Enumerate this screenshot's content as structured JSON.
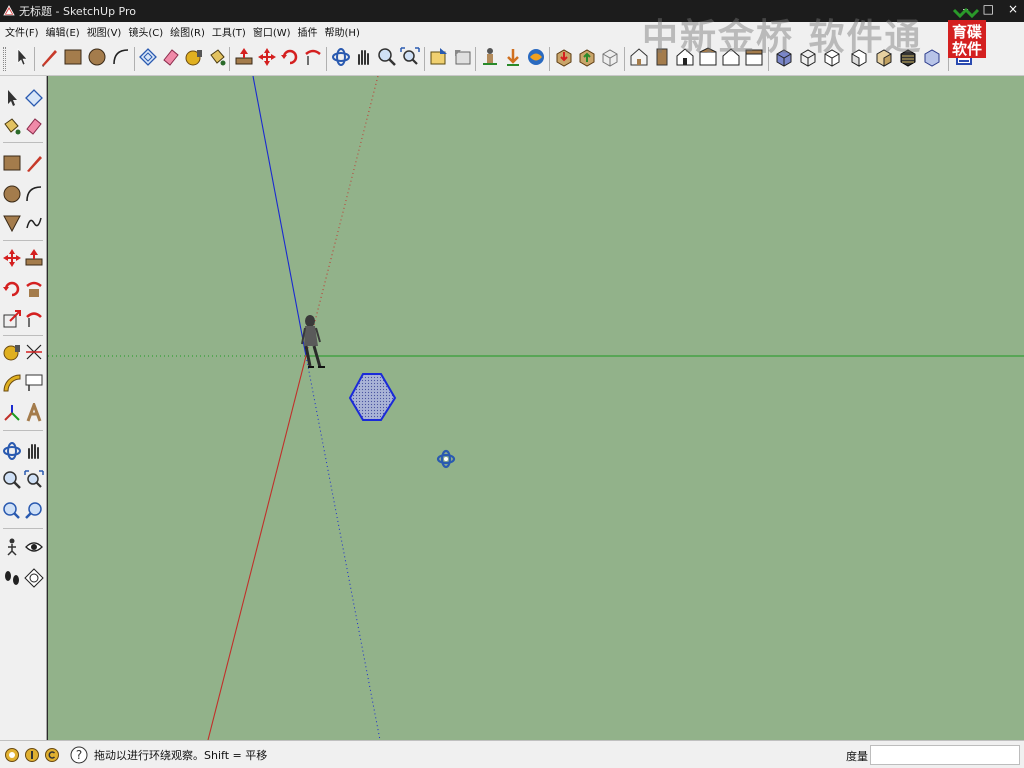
{
  "window": {
    "title": "无标题 - SketchUp Pro",
    "controls": [
      "–",
      "□",
      "×"
    ]
  },
  "menu": [
    "文件(F)",
    "编辑(E)",
    "视图(V)",
    "镜头(C)",
    "绘图(R)",
    "工具(T)",
    "窗口(W)",
    "插件",
    "帮助(H)"
  ],
  "watermark": {
    "text": "中新金桥 软件通",
    "logo_text": [
      "育碟",
      "软件"
    ],
    "colors": {
      "logo": "#d42020",
      "text": "#8a8a8a"
    }
  },
  "toolbar_icons": [
    "select-icon",
    "pencil-icon",
    "rectangle-icon",
    "circle-icon",
    "arc-icon",
    "make-component-icon",
    "eraser-icon",
    "tape-measure-icon",
    "paint-bucket-icon",
    "push-pull-icon",
    "move-icon",
    "rotate-icon",
    "follow-me-icon",
    "orbit-icon",
    "pan-icon",
    "zoom-icon",
    "zoom-extents-icon",
    "previous-view-icon",
    "next-view-icon",
    "position-camera-icon",
    "walk-icon",
    "look-around-icon",
    "get-models-icon",
    "share-model-icon",
    "components-icon",
    "iso-view-icon",
    "top-view-icon",
    "front-view-icon",
    "right-view-icon",
    "back-view-icon",
    "left-view-icon",
    "xray-icon",
    "wireframe-icon",
    "hidden-line-icon",
    "shaded-icon",
    "shaded-texture-icon",
    "monochrome-icon",
    "layers-icon"
  ],
  "left_toolbar_icons": [
    [
      "select-icon",
      "make-component-icon"
    ],
    [
      "paint-bucket-icon",
      "eraser-icon"
    ],
    [
      "rectangle-icon",
      "line-icon"
    ],
    [
      "circle-icon",
      "arc-icon"
    ],
    [
      "polygon-icon",
      "freehand-icon"
    ],
    [
      "move-icon",
      "push-pull-icon"
    ],
    [
      "rotate-icon",
      "follow-me-icon"
    ],
    [
      "scale-icon",
      "offset-icon"
    ],
    [
      "tape-measure-icon",
      "dimension-icon"
    ],
    [
      "protractor-icon",
      "text-icon"
    ],
    [
      "axes-icon",
      "3d-text-icon"
    ],
    [
      "orbit-icon",
      "pan-icon"
    ],
    [
      "zoom-icon",
      "zoom-window-icon"
    ],
    [
      "previous-icon",
      "zoom-extents-icon"
    ],
    [
      "position-camera-icon",
      "look-around-icon"
    ],
    [
      "walk-icon",
      "section-plane-icon"
    ]
  ],
  "colors": {
    "viewport_bg": "#92b28a",
    "axis_blue": "#1a2ad0",
    "axis_red": "#c0302a",
    "axis_green": "#1e9a22",
    "hexagon_stroke": "#1a2ad8",
    "hexagon_fill": "#a9b3d6"
  },
  "status": {
    "message": "拖动以进行环绕观察。Shift = 平移",
    "measure_label": "度量",
    "measure_value": ""
  }
}
